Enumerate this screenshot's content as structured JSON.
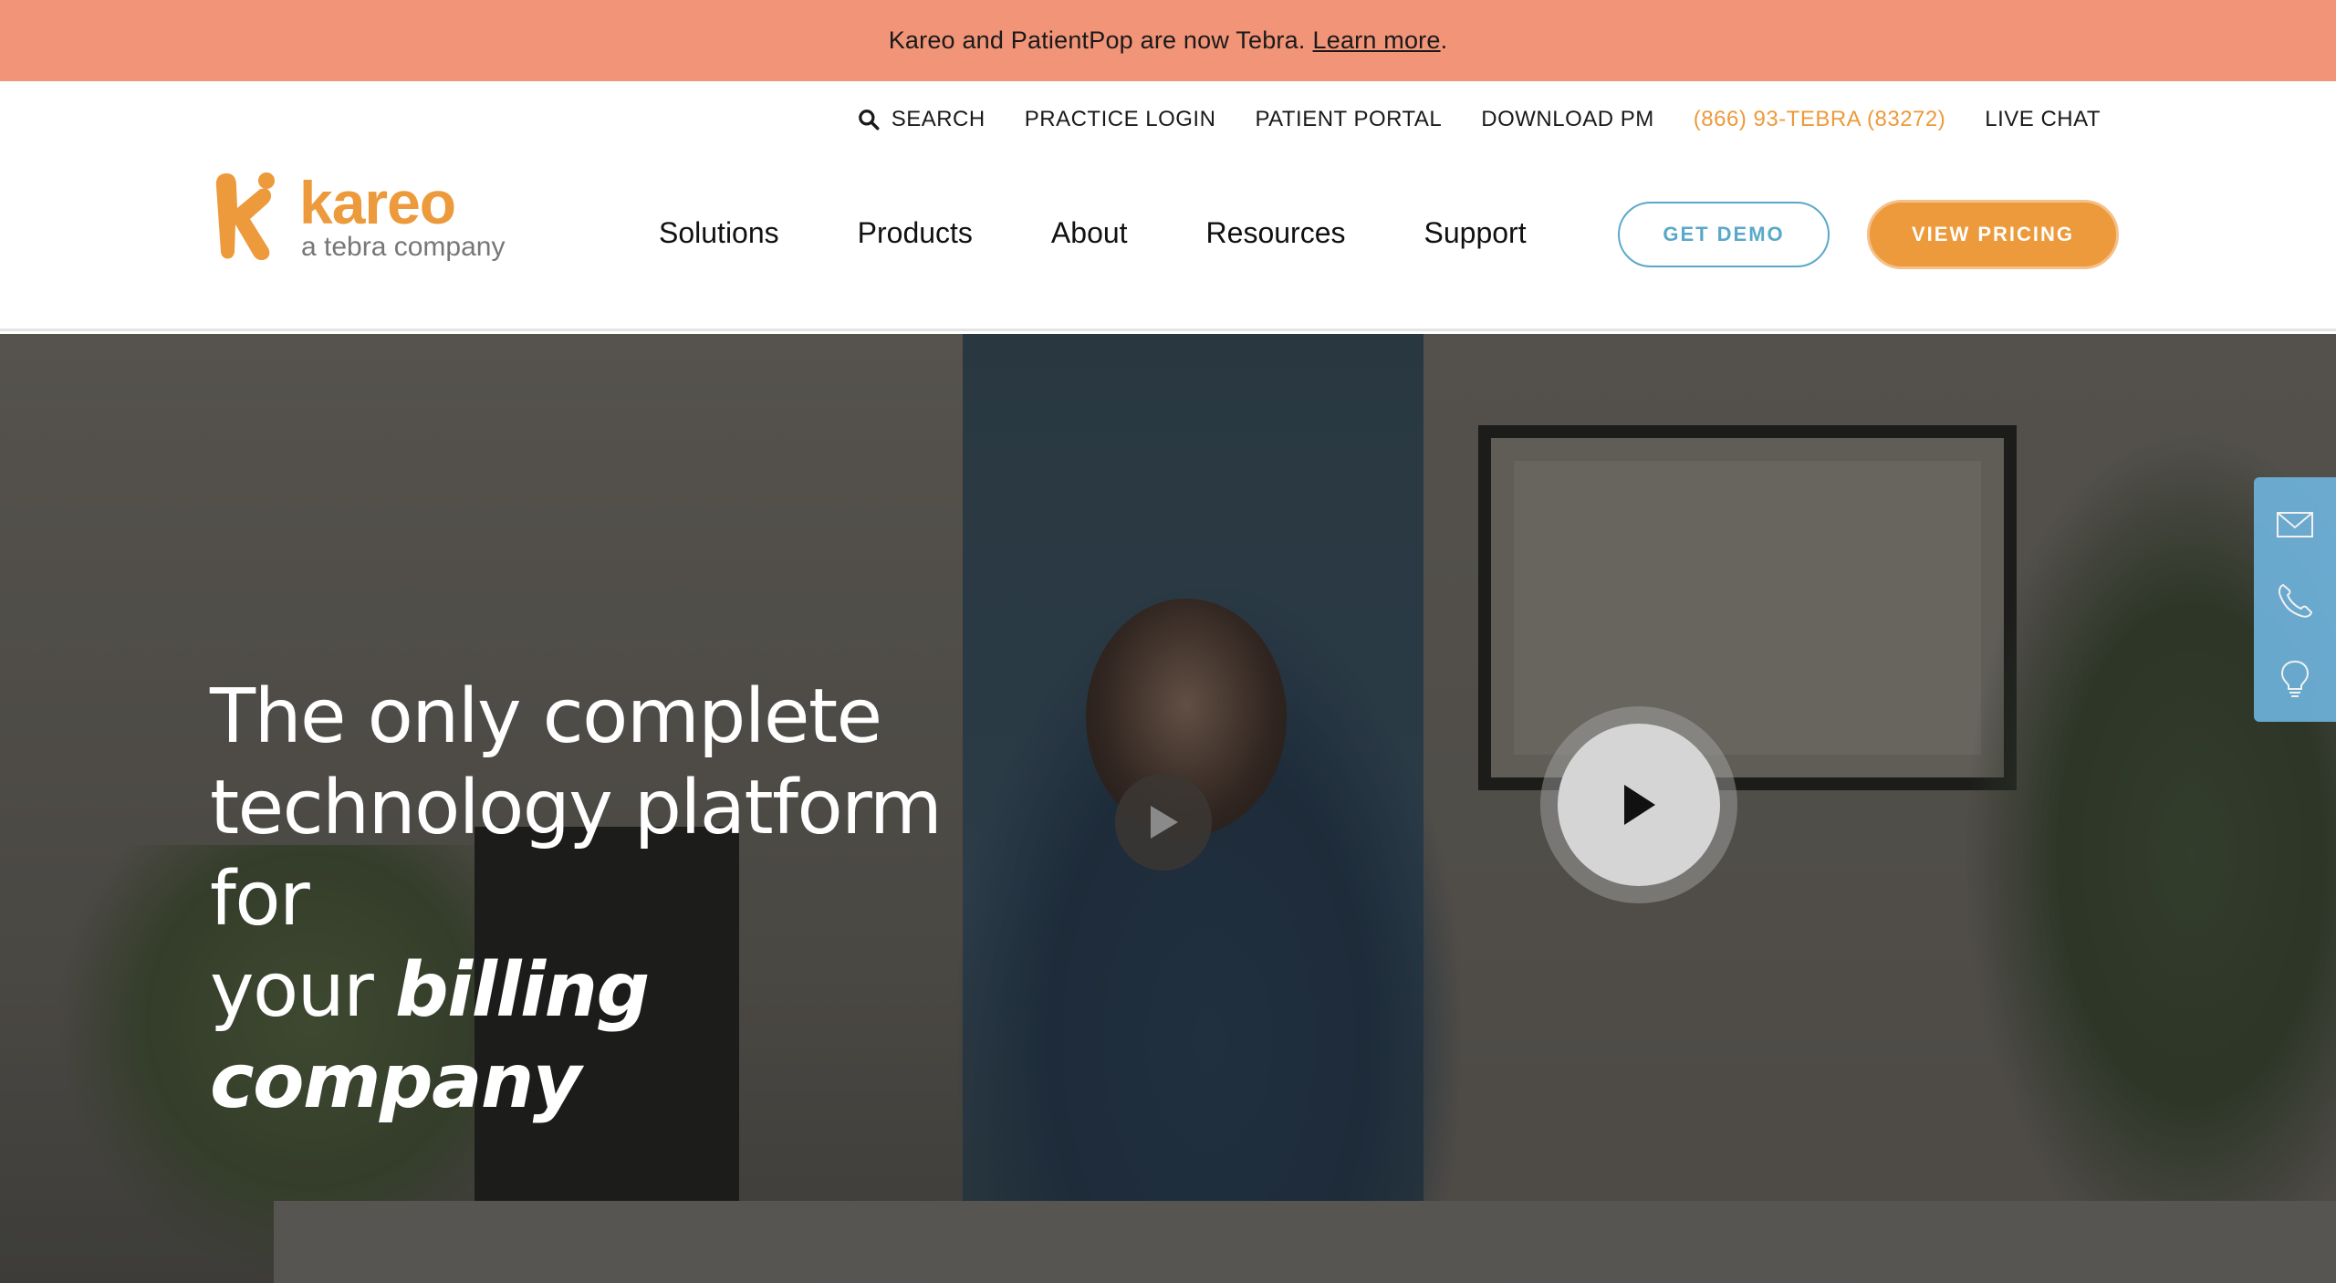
{
  "banner": {
    "text": "Kareo and PatientPop are now Tebra.",
    "link_label": "Learn more",
    "suffix": "."
  },
  "utility_nav": {
    "search_label": "SEARCH",
    "practice_login": "PRACTICE LOGIN",
    "patient_portal": "PATIENT PORTAL",
    "download_pm": "DOWNLOAD PM",
    "phone": "(866) 93-TEBRA (83272)",
    "live_chat": "LIVE CHAT"
  },
  "logo": {
    "wordmark": "kareo",
    "tagline": "a tebra company"
  },
  "main_nav": {
    "items": [
      "Solutions",
      "Products",
      "About",
      "Resources",
      "Support"
    ]
  },
  "cta": {
    "get_demo": "GET DEMO",
    "view_pricing": "VIEW PRICING"
  },
  "hero": {
    "line1": "The only complete",
    "line2": "technology platform for",
    "line3_prefix": "your ",
    "line3_emphasis": "billing company"
  },
  "side_panel": {
    "icons": [
      "mail-icon",
      "phone-icon",
      "lightbulb-icon"
    ]
  },
  "colors": {
    "banner": "#F29478",
    "brand_orange": "#EC9A3B",
    "demo_blue": "#5AA8C8",
    "side_panel": "#6EB1DA"
  }
}
